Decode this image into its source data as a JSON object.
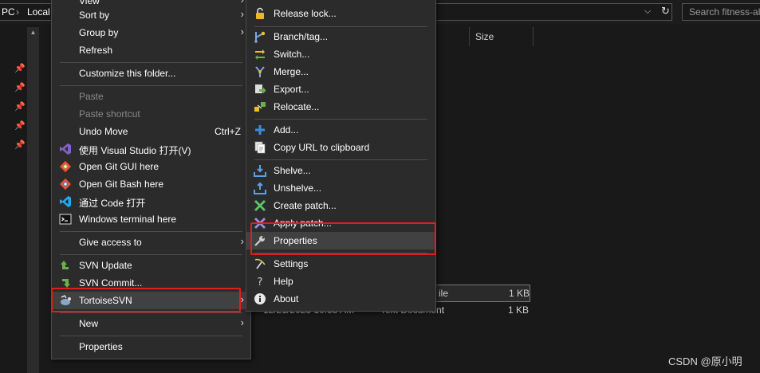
{
  "explorer": {
    "breadcrumbs": [
      "PC",
      "Local"
    ],
    "search_placeholder": "Search fitness-alg",
    "columns": [
      "Size"
    ],
    "files": [
      {
        "date": "",
        "type": "ile",
        "size": "1 KB"
      },
      {
        "date": "12/21/2023 10:55 AM",
        "type": "Text Document",
        "size": "1 KB"
      }
    ]
  },
  "context_menu": {
    "items": [
      {
        "label": "View",
        "arrow": true
      },
      {
        "label": "Sort by",
        "arrow": true
      },
      {
        "label": "Group by",
        "arrow": true
      },
      {
        "label": "Refresh"
      },
      {
        "label": "Customize this folder..."
      },
      {
        "label": "Paste",
        "disabled": true
      },
      {
        "label": "Paste shortcut",
        "disabled": true
      },
      {
        "label": "Undo Move",
        "shortcut": "Ctrl+Z"
      },
      {
        "label": "使用 Visual Studio 打开(V)",
        "icon": "visual-studio-icon"
      },
      {
        "label": "Open Git GUI here",
        "icon": "git-gui-icon"
      },
      {
        "label": "Open Git Bash here",
        "icon": "git-bash-icon"
      },
      {
        "label": "通过 Code 打开",
        "icon": "vscode-icon"
      },
      {
        "label": "Windows terminal here",
        "icon": "terminal-icon"
      },
      {
        "label": "Give access to",
        "arrow": true
      },
      {
        "label": "SVN Update",
        "icon": "svn-update-icon"
      },
      {
        "label": "SVN Commit...",
        "icon": "svn-commit-icon"
      },
      {
        "label": "TortoiseSVN",
        "icon": "tortoisesvn-icon",
        "arrow": true
      },
      {
        "label": "New",
        "arrow": true
      },
      {
        "label": "Properties"
      }
    ]
  },
  "tortoise_menu": {
    "items": [
      {
        "label": "Release lock...",
        "icon": "lock-icon"
      },
      {
        "label": "Branch/tag...",
        "icon": "branch-icon"
      },
      {
        "label": "Switch...",
        "icon": "switch-icon"
      },
      {
        "label": "Merge...",
        "icon": "merge-icon"
      },
      {
        "label": "Export...",
        "icon": "export-icon"
      },
      {
        "label": "Relocate...",
        "icon": "relocate-icon"
      },
      {
        "label": "Add...",
        "icon": "add-icon"
      },
      {
        "label": "Copy URL to clipboard",
        "icon": "copy-url-icon"
      },
      {
        "label": "Shelve...",
        "icon": "shelve-icon"
      },
      {
        "label": "Unshelve...",
        "icon": "unshelve-icon"
      },
      {
        "label": "Create patch...",
        "icon": "create-patch-icon"
      },
      {
        "label": "Apply patch...",
        "icon": "apply-patch-icon"
      },
      {
        "label": "Properties",
        "icon": "wrench-icon"
      },
      {
        "label": "Settings",
        "icon": "settings-icon"
      },
      {
        "label": "Help",
        "icon": "help-icon"
      },
      {
        "label": "About",
        "icon": "info-icon"
      }
    ]
  },
  "watermark": "CSDN @原小明",
  "colors": {
    "highlight_box": "#e01e1e",
    "menu_bg": "#2b2b2b",
    "hover_bg": "#414141"
  }
}
